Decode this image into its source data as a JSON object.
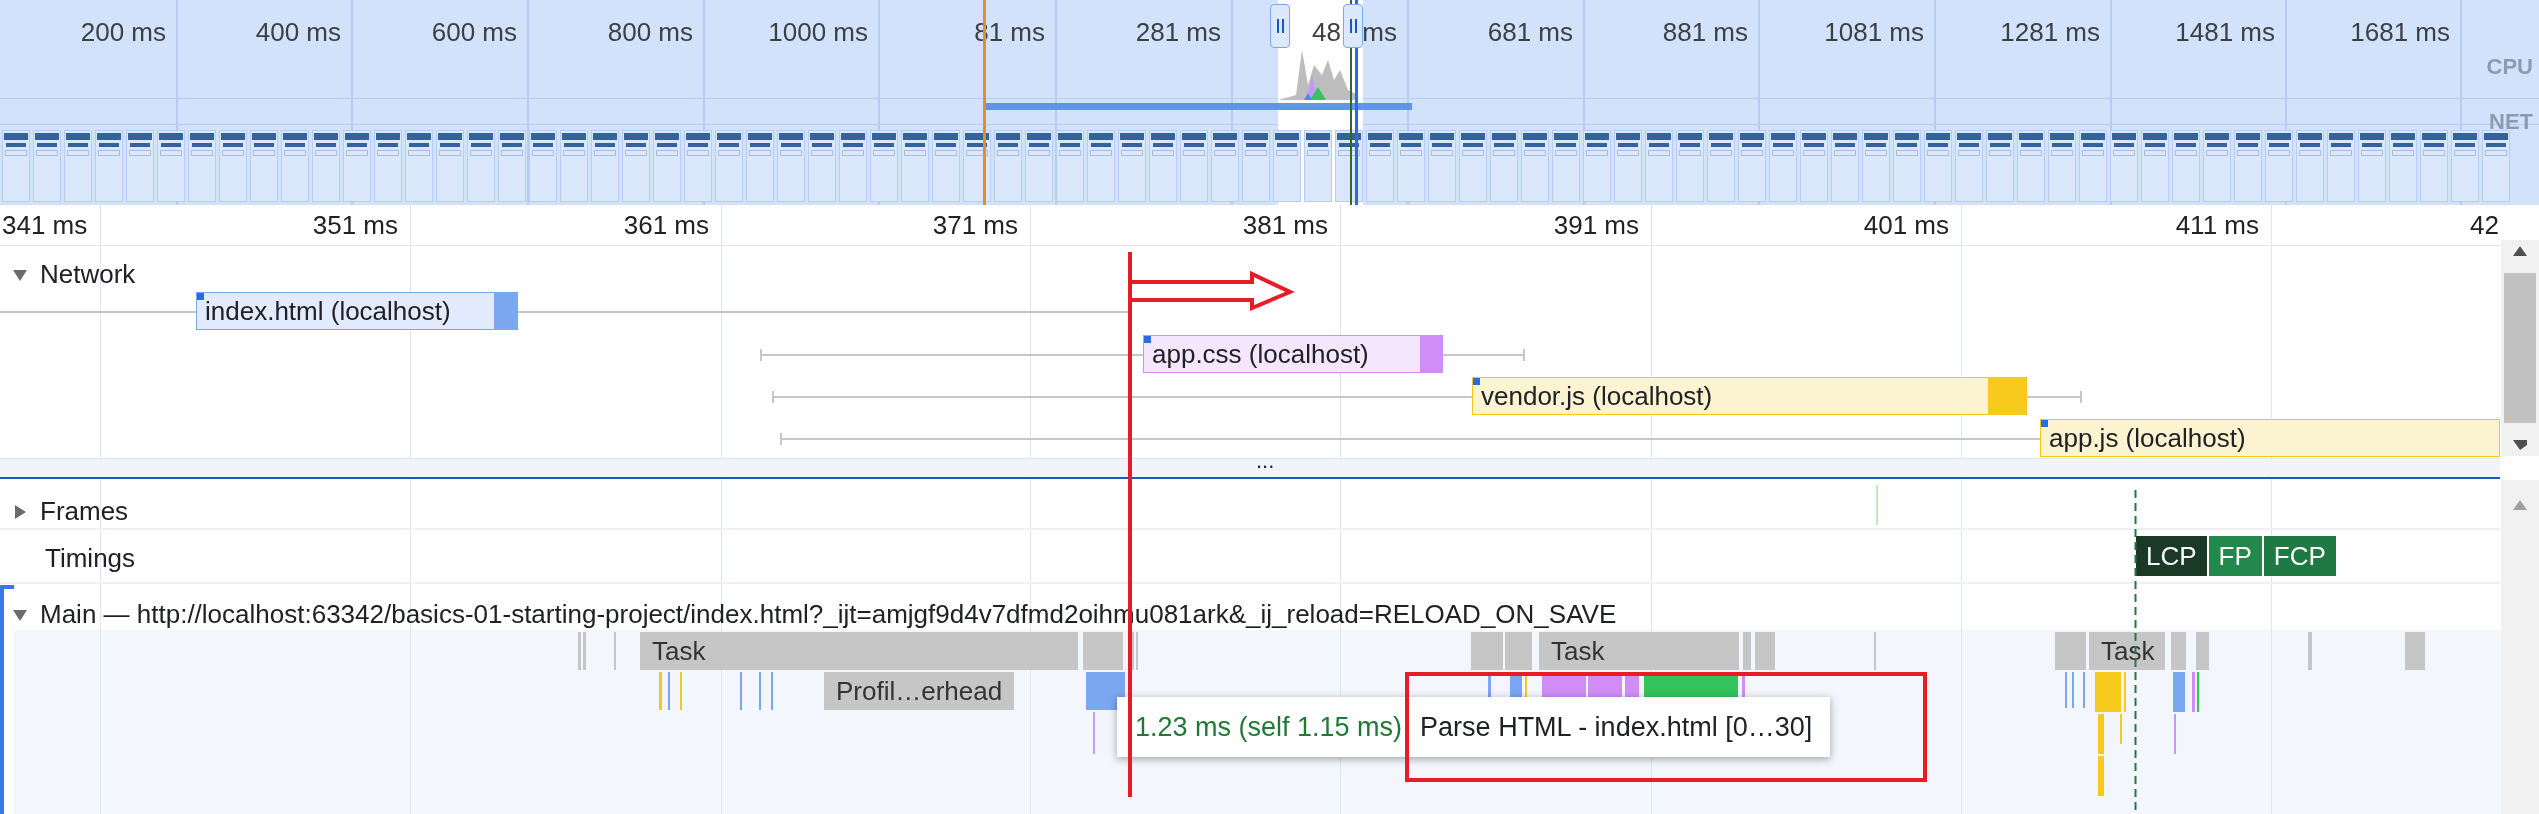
{
  "overview": {
    "ticks": [
      {
        "label": "200 ms"
      },
      {
        "label": "400 ms"
      },
      {
        "label": "600 ms"
      },
      {
        "label": "800 ms"
      },
      {
        "label": "1000 ms"
      },
      {
        "label": "81 ms"
      },
      {
        "label": "281 ms"
      },
      {
        "label": "48",
        "trailing": "ms"
      },
      {
        "label": "681 ms"
      },
      {
        "label": "881 ms"
      },
      {
        "label": "1081 ms"
      },
      {
        "label": "1281 ms"
      },
      {
        "label": "1481 ms"
      },
      {
        "label": "1681 ms"
      }
    ],
    "lanes": [
      "CPU",
      "NET"
    ]
  },
  "ruler": {
    "ticks": [
      "341 ms",
      "351 ms",
      "361 ms",
      "371 ms",
      "381 ms",
      "391 ms",
      "401 ms",
      "411 ms",
      "42"
    ]
  },
  "network": {
    "label": "Network",
    "expanded": true,
    "more": "...",
    "requests": [
      {
        "label": "index.html (localhost)",
        "kind": "html"
      },
      {
        "label": "app.css (localhost)",
        "kind": "css"
      },
      {
        "label": "vendor.js (localhost)",
        "kind": "js"
      },
      {
        "label": "app.js (localhost)",
        "kind": "js"
      }
    ]
  },
  "frames": {
    "label": "Frames",
    "expanded": false
  },
  "timings": {
    "label": "Timings",
    "markers": [
      {
        "label": "LCP",
        "color": "#1b3a26"
      },
      {
        "label": "FP",
        "color": "#22884b"
      },
      {
        "label": "FCP",
        "color": "#1e7a42"
      }
    ]
  },
  "main": {
    "label": "Main — http://localhost:63342/basics-01-starting-project/index.html?_ijt=amjgf9d4v7dfmd2oihmu081ark&_ij_reload=RELOAD_ON_SAVE",
    "expanded": true,
    "tasks": [
      "Task",
      "Task",
      "Task"
    ],
    "slices": [
      "Profil…erhead"
    ]
  },
  "tooltip": {
    "duration": "1.23 ms (self 1.15 ms)",
    "title": "Parse HTML - index.html [0…30]"
  }
}
